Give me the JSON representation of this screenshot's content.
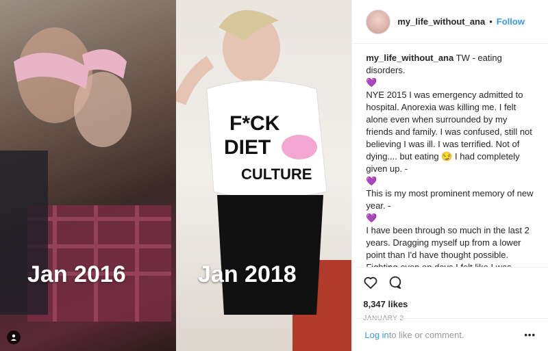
{
  "media": {
    "left_label": "Jan 2016",
    "right_label": "Jan 2018"
  },
  "header": {
    "username": "my_life_without_ana",
    "separator": "•",
    "follow_label": "Follow"
  },
  "caption": {
    "username": "my_life_without_ana",
    "intro": "TW - eating disorders.",
    "paragraph1": "NYE 2015 I was emergency admitted to hospital. Anorexia was killing me. I felt alone even when surrounded by my friends and family. I was confused, still not believing I was ill. I was terrified. Not of dying.... but eating 😏 I had completely given up. -",
    "paragraph2": "This is my most prominent memory of new year. -",
    "paragraph3": "I have been through so much in the last 2 years. Dragging myself up from a lower point than I'd have thought possible. Fighting even on days I felt like I was dying inside. But I've done it! I'm here! I'm alive against all odds! I beat ana!!! (She still try's but honestly she can F off 😏 )",
    "trailing": "-",
    "heart": "💜"
  },
  "actions": {
    "likes": "8,347 likes",
    "date": "JANUARY 2"
  },
  "footer": {
    "login_label": "Log in",
    "rest_text": " to like or comment.",
    "more_label": "•••"
  }
}
